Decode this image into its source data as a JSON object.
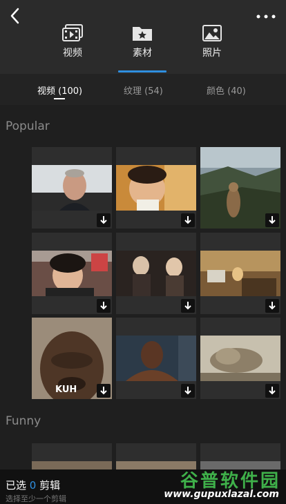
{
  "categories": [
    {
      "label": "视频",
      "icon": "video-film-icon"
    },
    {
      "label": "素材",
      "icon": "star-folder-icon"
    },
    {
      "label": "照片",
      "icon": "photo-icon"
    }
  ],
  "subtabs": [
    "视频 (100)",
    "纹理 (54)",
    "颜色 (40)"
  ],
  "sections": {
    "popular": "Popular",
    "funny": "Funny"
  },
  "tiles": [
    {
      "name": "bald-man-smiling",
      "caption": ""
    },
    {
      "name": "kid-talking",
      "caption": ""
    },
    {
      "name": "marmot-screaming",
      "caption": ""
    },
    {
      "name": "guy-shouting-room",
      "caption": ""
    },
    {
      "name": "women-shocked",
      "caption": ""
    },
    {
      "name": "office-rage",
      "caption": ""
    },
    {
      "name": "crying-man-kuh",
      "caption": "KUH"
    },
    {
      "name": "wrestler-laughing",
      "caption": ""
    },
    {
      "name": "explosion-dust",
      "caption": ""
    }
  ],
  "bottom": {
    "selected_prefix": "已选",
    "selected_count": "0",
    "selected_suffix": "剪辑",
    "hint": "选择至少一个剪辑"
  },
  "watermark": {
    "title": "谷普软件园",
    "url": "www.gupuxlazal.com"
  },
  "colors": {
    "accent": "#2f8fe0",
    "watermark_green": "#3fb04a"
  }
}
